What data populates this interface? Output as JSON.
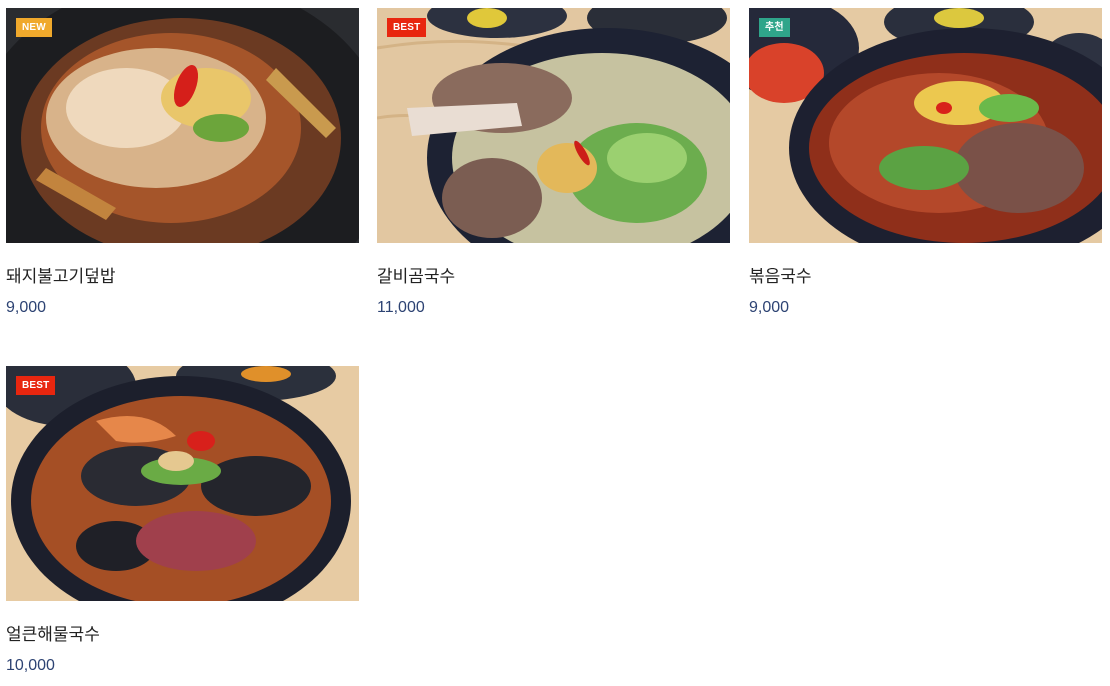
{
  "colors": {
    "badge_new": "#f0a92c",
    "badge_best": "#e8260f",
    "badge_recommend": "#2fa58a",
    "price_text": "#2d4373",
    "name_text": "#222222"
  },
  "menu": {
    "items": [
      {
        "name": "돼지불고기덮밥",
        "price": "9,000",
        "badge": "NEW",
        "badge_color": "#f0a92c",
        "photo": "pork-bulgogi-rice-bowl-photo"
      },
      {
        "name": "갈비곰국수",
        "price": "11,000",
        "badge": "BEST",
        "badge_color": "#e8260f",
        "photo": "galbi-gom-noodle-soup-photo"
      },
      {
        "name": "볶음국수",
        "price": "9,000",
        "badge": "추천",
        "badge_color": "#2fa58a",
        "photo": "stir-fried-noodles-photo"
      },
      {
        "name": "얼큰해물국수",
        "price": "10,000",
        "badge": "BEST",
        "badge_color": "#e8260f",
        "photo": "spicy-seafood-noodle-soup-photo"
      }
    ]
  }
}
